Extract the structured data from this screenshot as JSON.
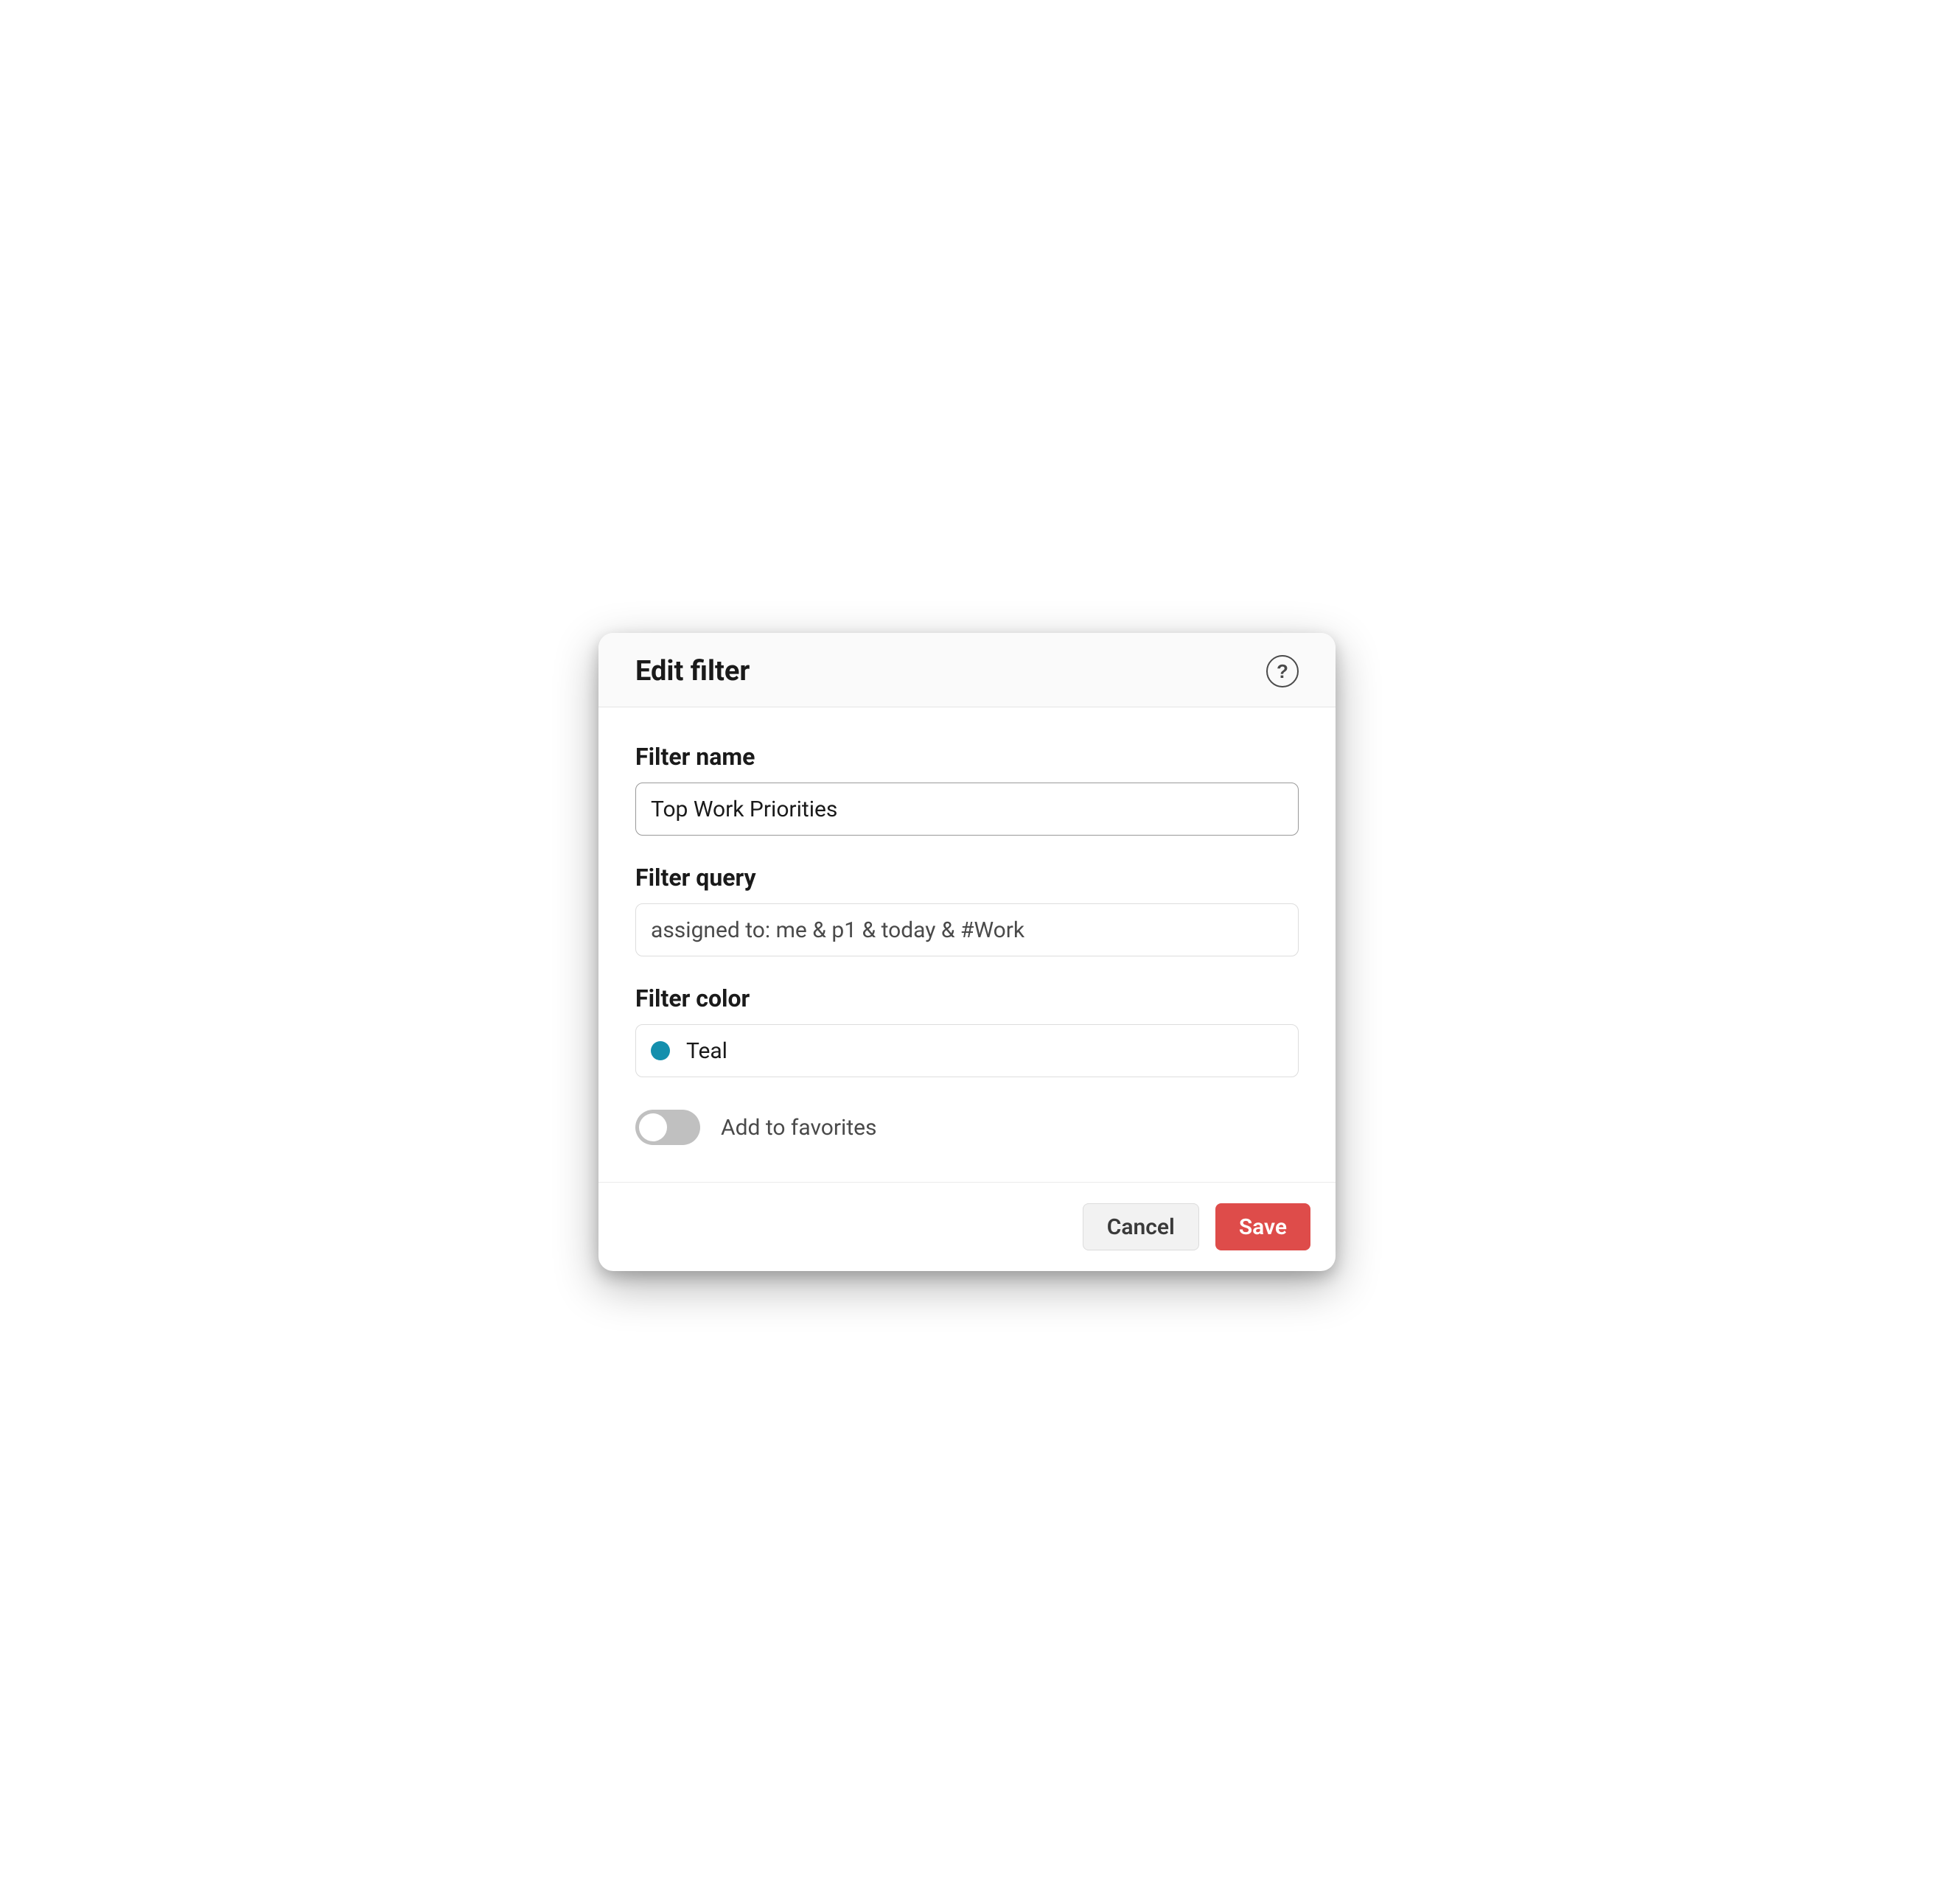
{
  "header": {
    "title": "Edit filter"
  },
  "form": {
    "name": {
      "label": "Filter name",
      "value": "Top Work Priorities"
    },
    "query": {
      "label": "Filter query",
      "value": "assigned to: me & p1 & today & #Work"
    },
    "color": {
      "label": "Filter color",
      "selected_name": "Teal",
      "selected_hex": "#148fad"
    },
    "favorites": {
      "label": "Add to favorites",
      "enabled": false
    }
  },
  "footer": {
    "cancel_label": "Cancel",
    "save_label": "Save"
  }
}
